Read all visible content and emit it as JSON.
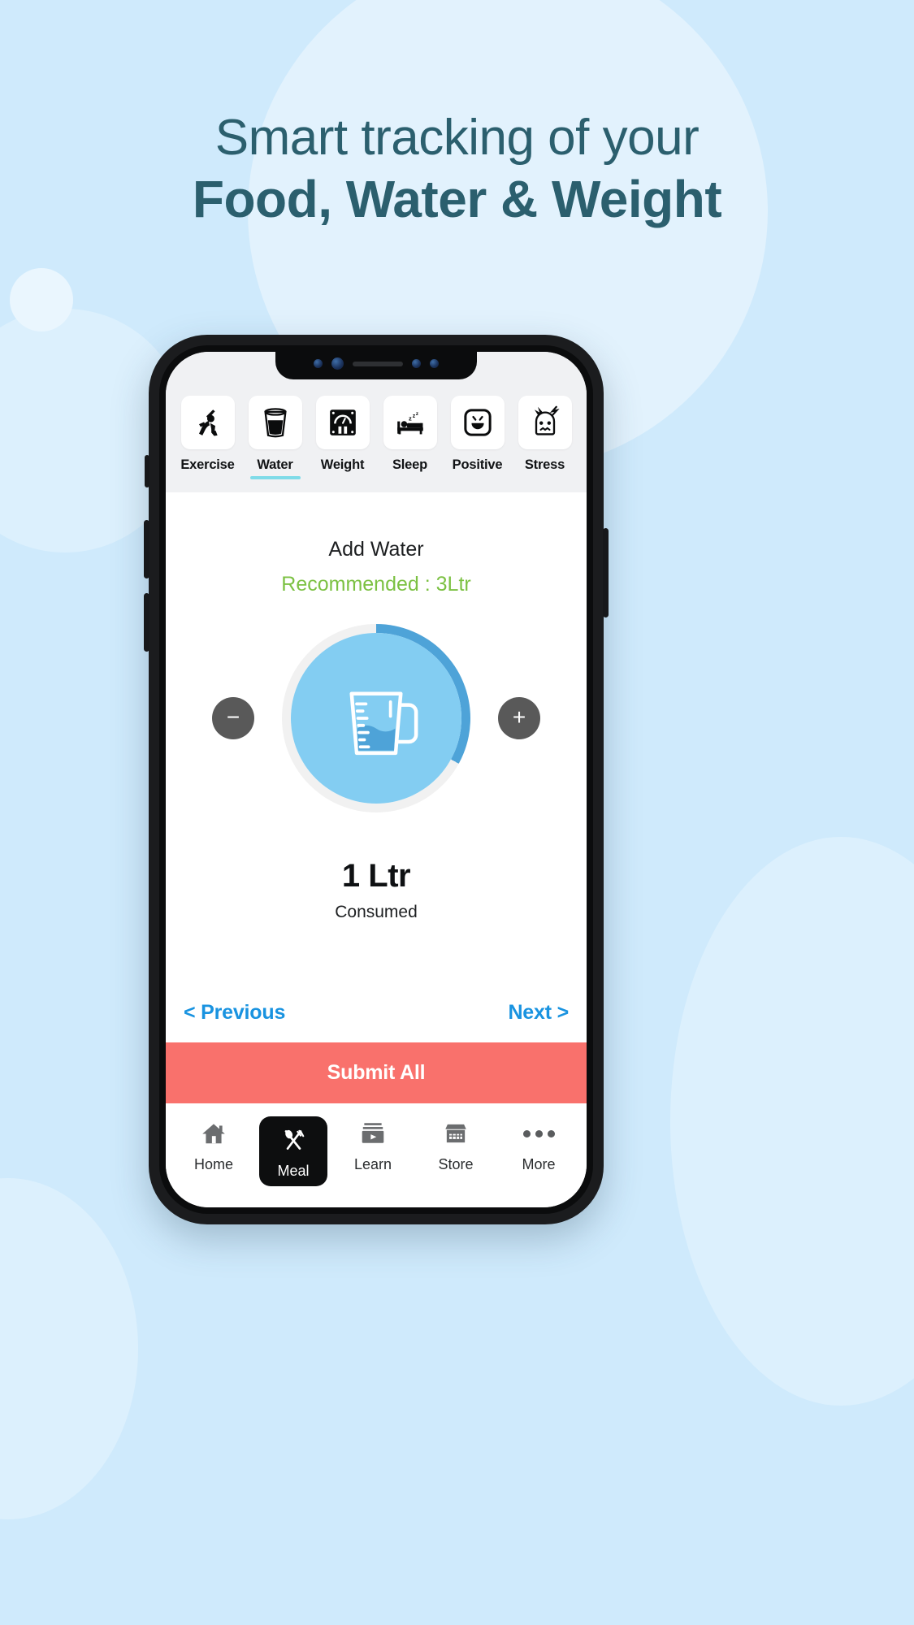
{
  "headline": {
    "line1": "Smart tracking of your",
    "line2": "Food, Water & Weight",
    "color": "#2b5f6e"
  },
  "colors": {
    "page_background": "#cfeafc",
    "accent_blue": "#1993e0",
    "dial_fill": "#83cdf2",
    "dial_progress": "#4ea3d8",
    "submit_red": "#f9716c",
    "recommended_green": "#7cc143",
    "active_tab_underline": "#7fdbe8"
  },
  "phone": {
    "categories": [
      {
        "label": "Exercise",
        "icon": "exercise-icon",
        "active": false
      },
      {
        "label": "Water",
        "icon": "water-glass-icon",
        "active": true
      },
      {
        "label": "Weight",
        "icon": "weighing-scale-icon",
        "active": false
      },
      {
        "label": "Sleep",
        "icon": "sleep-bed-icon",
        "active": false
      },
      {
        "label": "Positive",
        "icon": "smiley-face-icon",
        "active": false
      },
      {
        "label": "Stress",
        "icon": "stress-head-icon",
        "active": false
      }
    ],
    "water": {
      "title": "Add Water",
      "recommended": "Recommended : 3Ltr",
      "decrease_label": "−",
      "increase_label": "+",
      "amount": "1 Ltr",
      "caption": "Consumed",
      "progress_percent": 33,
      "jug_icon": "measuring-jug-icon"
    },
    "pager": {
      "previous": "< Previous",
      "next": "Next >"
    },
    "submit_label": "Submit All",
    "bottom_nav": [
      {
        "label": "Home",
        "icon": "home-icon",
        "active": false
      },
      {
        "label": "Meal",
        "icon": "cutlery-icon",
        "active": true
      },
      {
        "label": "Learn",
        "icon": "video-list-icon",
        "active": false
      },
      {
        "label": "Store",
        "icon": "shop-icon",
        "active": false
      },
      {
        "label": "More",
        "icon": "ellipsis-icon",
        "active": false
      }
    ]
  }
}
